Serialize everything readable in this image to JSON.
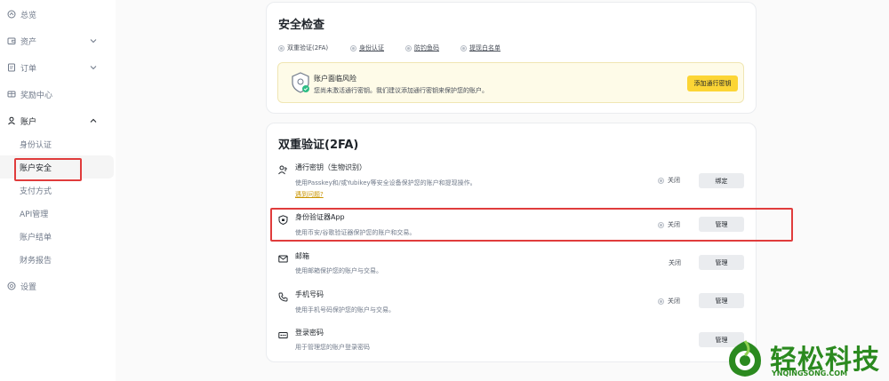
{
  "sidebar": {
    "overview": "总览",
    "assets": "资产",
    "orders": "订单",
    "rewards": "奖励中心",
    "account": "账户",
    "sub": [
      "身份认证",
      "账户安全",
      "支付方式",
      "API管理",
      "账户结单",
      "财务报告"
    ],
    "settings": "设置"
  },
  "security_check": {
    "title": "安全检查",
    "items": [
      "双重验证(2FA)",
      "身份认证",
      "防钓鱼码",
      "提现白名单"
    ],
    "risk": {
      "title": "账户面临风险",
      "desc": "您尚未激活通行密钥。我们建议添加通行密钥来保护您的账户。",
      "button": "添加通行密钥"
    }
  },
  "twofa": {
    "title": "双重验证(2FA)",
    "rows": [
      {
        "title": "通行密钥（生物识别）",
        "desc": "使用Passkey和/或Yubikey等安全设备保护您的账户和提现操作。",
        "link": "遇到问题?",
        "status": "关闭",
        "button": "绑定",
        "icon": "passkey-icon"
      },
      {
        "title": "身份验证器App",
        "desc": "使用币安/谷歌验证器保护您的账户和交易。",
        "status": "关闭",
        "button": "管理",
        "icon": "authenticator-icon"
      },
      {
        "title": "邮箱",
        "desc": "使用邮箱保护您的账户与交易。",
        "status": "关闭",
        "button": "管理",
        "icon": "mail-icon"
      },
      {
        "title": "手机号码",
        "desc": "使用手机号码保护您的账户与交易。",
        "status": "关闭",
        "button": "管理",
        "icon": "phone-icon"
      },
      {
        "title": "登录密码",
        "desc": "用于管理您的账户登录密码",
        "button": "管理",
        "icon": "password-icon"
      }
    ]
  },
  "watermark": {
    "cn": "轻松科技",
    "en": "YNQINGSONG.COM"
  },
  "colors": {
    "highlight_red": "#e03c3c",
    "brand_yellow": "#fcd535",
    "link_gold": "#c99400",
    "watermark_green": "#2b8a1f"
  }
}
